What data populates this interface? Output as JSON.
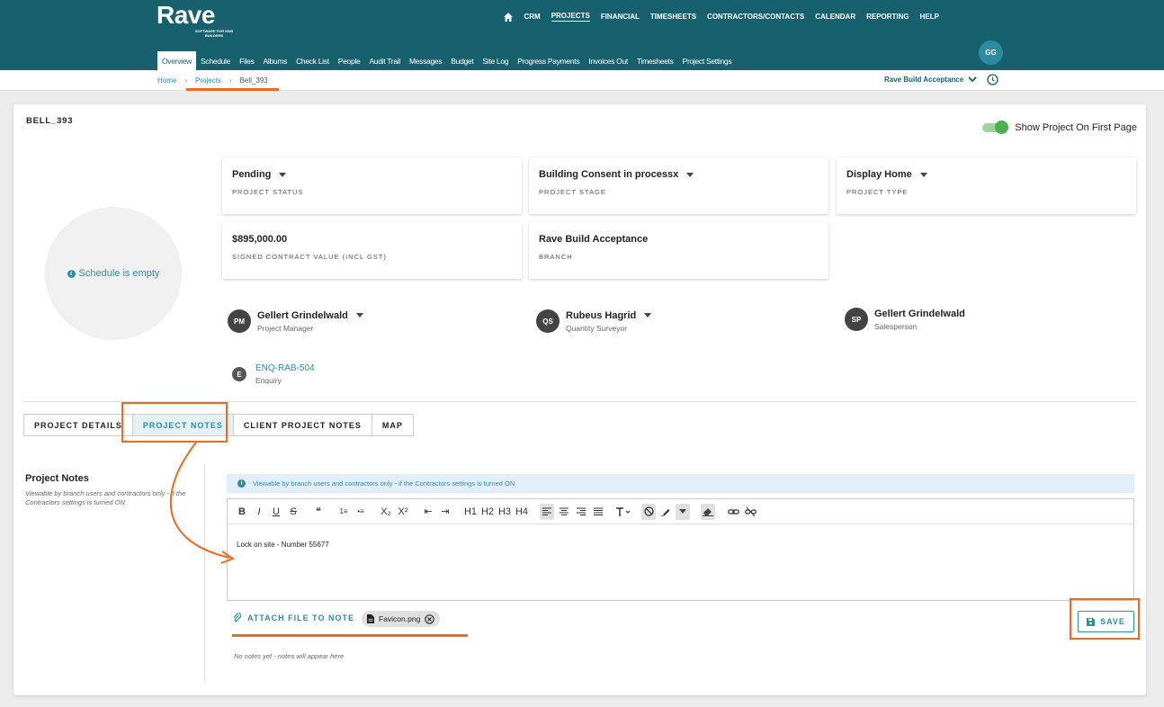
{
  "brand": {
    "name": "Rave",
    "tagline": "SOFTWARE FOR KIWI BUILDERS"
  },
  "topnav": [
    "CRM",
    "PROJECTS",
    "FINANCIAL",
    "TIMESHEETS",
    "CONTRACTORS/CONTACTS",
    "CALENDAR",
    "REPORTING",
    "HELP"
  ],
  "subnav": [
    "Overview",
    "Schedule",
    "Files",
    "Albums",
    "Check List",
    "People",
    "Audit Trail",
    "Messages",
    "Budget",
    "Site Log",
    "Progress Payments",
    "Invoices Out",
    "Timesheets",
    "Project Settings"
  ],
  "user_initials": "GG",
  "breadcrumb": {
    "home": "Home",
    "projects": "Projects",
    "current": "Bell_393"
  },
  "branch_selector": "Rave Build Acceptance",
  "project": {
    "code": "BELL_393",
    "toggle_label": "Show Project On First Page",
    "schedule_empty": "Schedule is empty",
    "status": {
      "value": "Pending",
      "label": "PROJECT STATUS"
    },
    "stage": {
      "value": "Building Consent in processx",
      "label": "PROJECT STAGE"
    },
    "type": {
      "value": "Display Home",
      "label": "PROJECT TYPE"
    },
    "contract": {
      "value": "$895,000.00",
      "label": "SIGNED CONTRACT VALUE (INCL GST)"
    },
    "branch": {
      "value": "Rave Build Acceptance",
      "label": "BRANCH"
    },
    "people": [
      {
        "initials": "PM",
        "name": "Gellert Grindelwald",
        "role": "Project Manager"
      },
      {
        "initials": "QS",
        "name": "Rubeus Hagrid",
        "role": "Quantity Surveyor"
      },
      {
        "initials": "SP",
        "name": "Gellert Grindelwald",
        "role": "Salesperson"
      }
    ],
    "enquiry": {
      "initial": "E",
      "code": "ENQ-RAB-504",
      "label": "Enquiry"
    }
  },
  "tabs": [
    "PROJECT DETAILS",
    "PROJECT NOTES",
    "CLIENT PROJECT NOTES",
    "MAP"
  ],
  "notes": {
    "title": "Project Notes",
    "desc": "Viewable by branch users and contractors only - if the Contractors settings is turned ON",
    "banner": "Viewable by branch users and contractors only - if the Contractors settings is turned ON",
    "content": "Lock on site - Number 55677",
    "attach_label": "ATTACH FILE TO NOTE",
    "attachment": "Favicon.png",
    "save_label": "SAVE",
    "empty": "No notes yet - notes will appear here"
  },
  "toolbar": [
    "B",
    "I",
    "U",
    "S",
    "❝",
    "1≡",
    "•≡",
    "X₂",
    "X²",
    "⇤",
    "⇥",
    "H1",
    "H2",
    "H3",
    "H4"
  ],
  "colors": {
    "brand": "#17606d",
    "accent": "#2b8ea0",
    "highlight": "#ef6a1f"
  }
}
